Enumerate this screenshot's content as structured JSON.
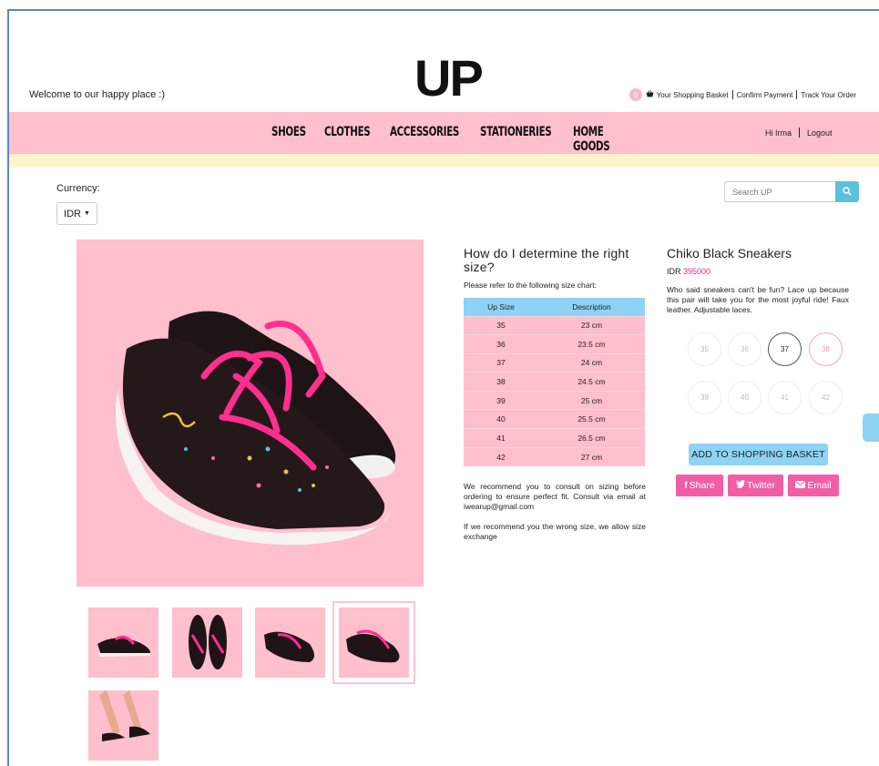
{
  "header": {
    "welcome": "Welcome to our happy place :)",
    "logo": "UP",
    "cart_count": "0",
    "links": [
      "Your Shopping Basket",
      "Confirm Payment",
      "Track Your Order"
    ]
  },
  "nav": {
    "items": [
      "SHOES",
      "CLOTHES",
      "ACCESSORIES",
      "STATIONERIES",
      "HOME GOODS"
    ],
    "greeting": "Hi Irma",
    "logout": "Logout"
  },
  "currency": {
    "label": "Currency:",
    "selected": "IDR"
  },
  "search": {
    "placeholder": "Search UP"
  },
  "size_chart": {
    "title": "How do I determine the right size?",
    "subtitle": "Please refer to the following size chart:",
    "headers": [
      "Up Size",
      "Description"
    ],
    "rows": [
      [
        "35",
        "23 cm"
      ],
      [
        "36",
        "23.5 cm"
      ],
      [
        "37",
        "24 cm"
      ],
      [
        "38",
        "24.5 cm"
      ],
      [
        "39",
        "25 cm"
      ],
      [
        "40",
        "25.5 cm"
      ],
      [
        "41",
        "26.5 cm"
      ],
      [
        "42",
        "27 cm"
      ]
    ],
    "recommend": "We recommend you to consult on sizing before ordering to ensure perfect fit. Consult via email at iwearup@gmail.com",
    "exchange": "If we recommend you the wrong size, we allow size exchange"
  },
  "product": {
    "name": "Chiko Black Sneakers",
    "currency": "IDR",
    "price": "395000",
    "description": "Who said sneakers can't be fun? Lace up because this pair will take you for the most joyful ride! Faux leather. Adjustable laces.",
    "sizes": [
      "35",
      "36",
      "37",
      "38",
      "39",
      "40",
      "41",
      "42"
    ],
    "selected_size": "37",
    "add_to_basket": "ADD TO SHOPPING BASKET",
    "share": [
      "Share",
      "Twitter",
      "Email"
    ]
  },
  "colors": {
    "pink": "#ffbfcd",
    "cream": "#fff4cf",
    "blue": "#8ed2f4",
    "magenta": "#f25ea6",
    "price": "#e0287a"
  }
}
